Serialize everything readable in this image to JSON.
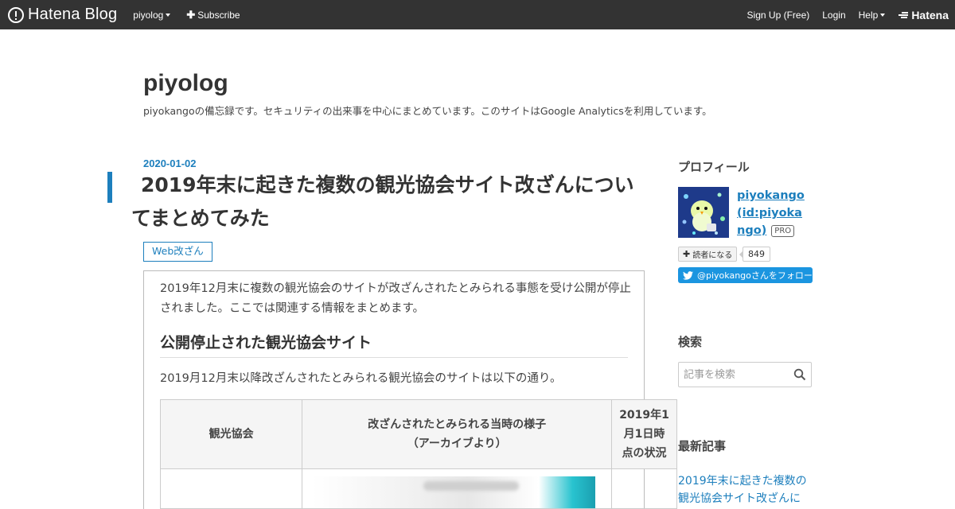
{
  "topbar": {
    "brand": "Hatena Blog",
    "blog_menu": "piyolog",
    "subscribe": "Subscribe",
    "signup": "Sign Up (Free)",
    "login": "Login",
    "help": "Help",
    "hatena": "Hatena"
  },
  "header": {
    "title": "piyolog",
    "description": "piyokangoの備忘録です。セキュリティの出来事を中心にまとめています。このサイトはGoogle Analyticsを利用しています。"
  },
  "article": {
    "date": "2020-01-02",
    "title": "2019年末に起きた複数の観光協会サイト改ざんについてまとめてみた",
    "category": "Web改ざん",
    "intro": "2019年12月末に複数の観光協会のサイトが改ざんされたとみられる事態を受け公開が停止されました。ここでは関連する情報をまとめます。",
    "section_heading": "公開停止された観光協会サイト",
    "section_text": "2019月12月末以降改ざんされたとみられる観光協会のサイトは以下の通り。",
    "table": {
      "headers": [
        "観光協会",
        "改ざんされたとみられる当時の様子\n（アーカイブより）",
        "2019年1月1日時点の状況"
      ]
    }
  },
  "sidebar": {
    "profile_heading": "プロフィール",
    "profile_name": "piyokango (id:piyokango)",
    "pro_badge": "PRO",
    "reader_button": "読者になる",
    "reader_count": "849",
    "twitter_follow": "@piyokangoさんをフォロー",
    "search_heading": "検索",
    "search_placeholder": "記事を検索",
    "recent_heading": "最新記事",
    "recent_link": "2019年末に起きた複数の観光協会サイト改ざんに"
  },
  "colors": {
    "topbar_bg": "#333333",
    "accent": "#1d7fbd",
    "twitter": "#1b95e0"
  }
}
